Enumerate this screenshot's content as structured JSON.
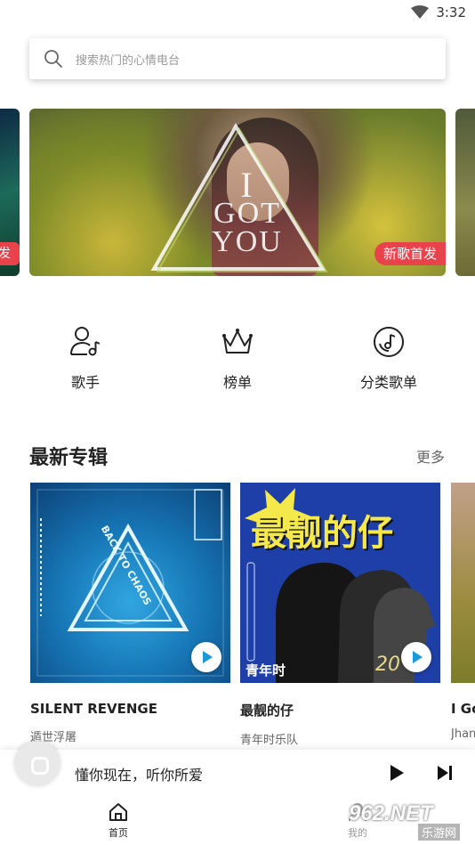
{
  "status_bar": {
    "time": "3:32",
    "wifi_icon": "wifi-icon"
  },
  "search": {
    "placeholder": "搜索热门的心情电台"
  },
  "banner": {
    "title_line1": "I",
    "title_line2": "GOT",
    "title_line3": "YOU",
    "tag": "新歌首发",
    "side_left_tag": "发"
  },
  "quick_nav": [
    {
      "label": "歌手",
      "icon": "singer-icon"
    },
    {
      "label": "榜单",
      "icon": "crown-icon"
    },
    {
      "label": "分类歌单",
      "icon": "disc-music-icon"
    }
  ],
  "latest_albums": {
    "title": "最新专辑",
    "more": "更多",
    "items": [
      {
        "name": "SILENT REVENGE",
        "artist": "遁世浮屠",
        "cover_text": "BACK TO CHAOS"
      },
      {
        "name": "最靓的仔",
        "artist": "青年时乐队",
        "cover_text": "最靓的仔",
        "cover_sub": "青年时",
        "cover_year": "20"
      },
      {
        "name": "I Go",
        "artist": "Jhan"
      }
    ]
  },
  "mini_player": {
    "text": "懂你现在，听你所爱"
  },
  "tab_bar": {
    "home_label": "首页",
    "mine_label": "我的"
  },
  "watermark": {
    "brand": "962.NET",
    "sub": "乐游网"
  },
  "colors": {
    "accent_red": "#e8424b",
    "play_blue": "#1a9bd8"
  }
}
